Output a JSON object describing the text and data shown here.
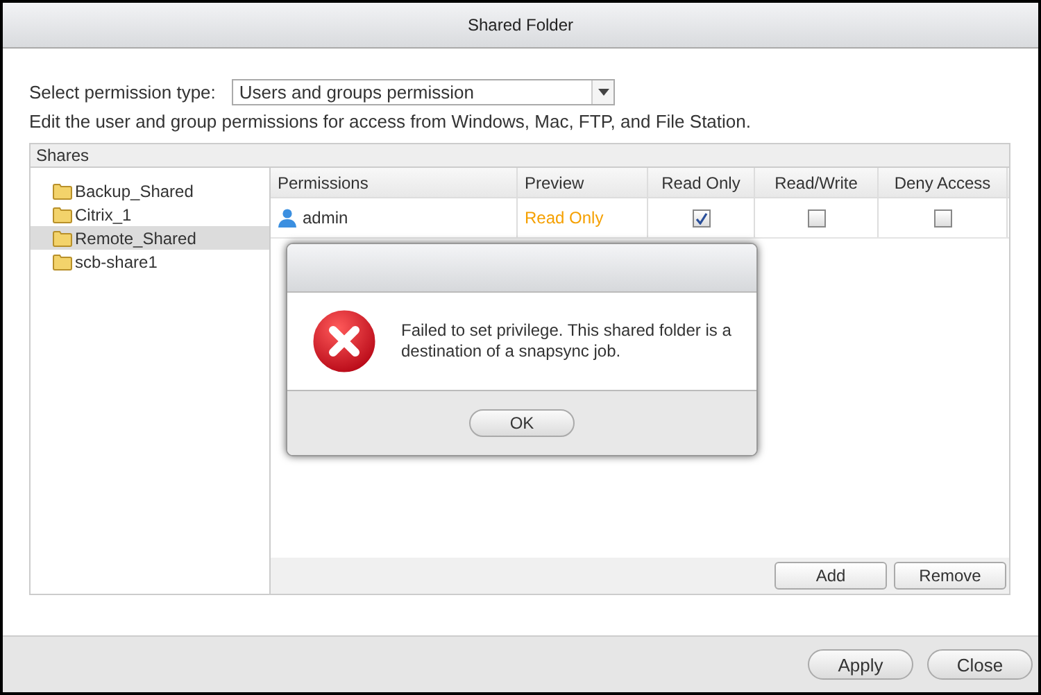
{
  "window": {
    "title": "Shared Folder"
  },
  "permission_type": {
    "label": "Select permission type:",
    "value": "Users and groups permission"
  },
  "description": "Edit the user and group permissions for access from Windows, Mac, FTP, and File Station.",
  "shares": {
    "title": "Shares",
    "items": [
      {
        "label": "Backup_Shared",
        "selected": false
      },
      {
        "label": "Citrix_1",
        "selected": false
      },
      {
        "label": "Remote_Shared",
        "selected": true
      },
      {
        "label": "scb-share1",
        "selected": false
      }
    ]
  },
  "table": {
    "columns": [
      "Permissions",
      "Preview",
      "Read Only",
      "Read/Write",
      "Deny Access"
    ],
    "rows": [
      {
        "name": "admin",
        "preview": "Read Only",
        "read_only": true,
        "read_write": false,
        "deny_access": false
      }
    ]
  },
  "table_buttons": [
    "Add",
    "Remove"
  ],
  "dialog": {
    "message": "Failed to set privilege. This shared folder is a destination of a snapsync job.",
    "button": "OK"
  },
  "footer_buttons": [
    "Apply",
    "Close"
  ]
}
